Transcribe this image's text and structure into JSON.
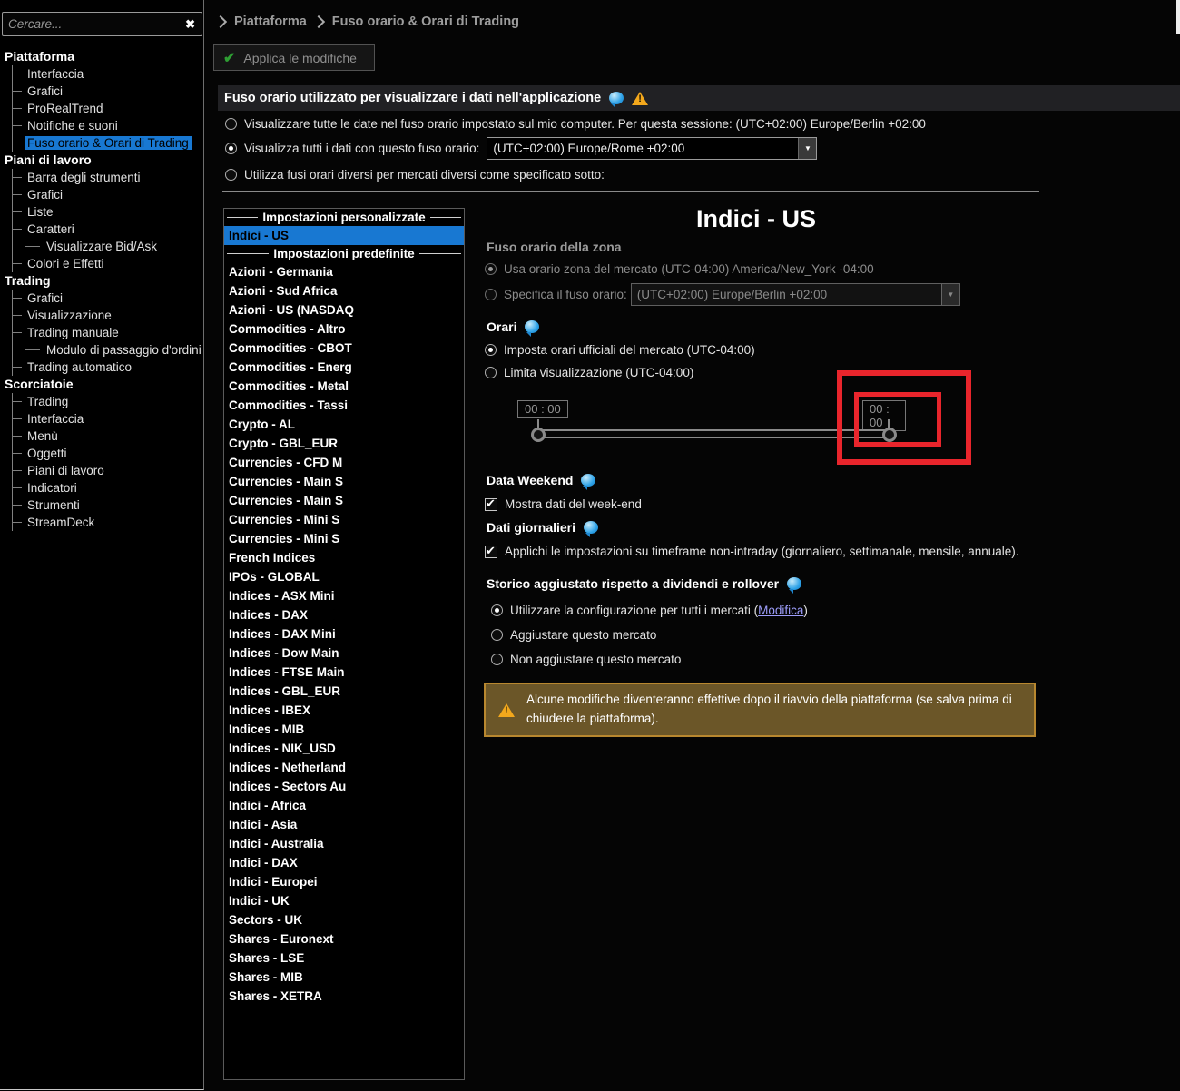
{
  "search": {
    "placeholder": "Cercare...",
    "clear_icon": "✖"
  },
  "breadcrumb": {
    "items": [
      "Piattaforma",
      "Fuso orario & Orari di Trading"
    ]
  },
  "toolbar": {
    "apply_label": "Applica le modifiche"
  },
  "timezone_header": {
    "title": "Fuso orario utilizzato per visualizzare i dati nell'applicazione"
  },
  "timezone_options": {
    "option1": "Visualizzare tutte le date nel fuso orario impostato sul mio computer. Per questa sessione: (UTC+02:00) Europe/Berlin +02:00",
    "option2": "Visualizza tutti i dati con questo fuso orario:",
    "option2_value": "(UTC+02:00) Europe/Rome +02:00",
    "option3": "Utilizza fusi orari diversi per mercati diversi come specificato sotto:"
  },
  "sidebar": {
    "tree": [
      {
        "type": "section",
        "label": "Piattaforma"
      },
      {
        "type": "item",
        "label": "Interfaccia"
      },
      {
        "type": "item",
        "label": "Grafici"
      },
      {
        "type": "item",
        "label": "ProRealTrend"
      },
      {
        "type": "item",
        "label": "Notifiche e suoni"
      },
      {
        "type": "item",
        "label": "Fuso orario & Orari di Trading",
        "selected": true
      },
      {
        "type": "section",
        "label": "Piani di lavoro"
      },
      {
        "type": "item",
        "label": "Barra degli strumenti"
      },
      {
        "type": "item",
        "label": "Grafici"
      },
      {
        "type": "item",
        "label": "Liste"
      },
      {
        "type": "item",
        "label": "Caratteri"
      },
      {
        "type": "subitem",
        "label": "Visualizzare Bid/Ask"
      },
      {
        "type": "item",
        "label": "Colori e Effetti"
      },
      {
        "type": "section",
        "label": "Trading"
      },
      {
        "type": "item",
        "label": "Grafici"
      },
      {
        "type": "item",
        "label": "Visualizzazione"
      },
      {
        "type": "item",
        "label": "Trading manuale"
      },
      {
        "type": "subitem",
        "label": "Modulo di passaggio d'ordini"
      },
      {
        "type": "item",
        "label": "Trading automatico"
      },
      {
        "type": "section",
        "label": "Scorciatoie"
      },
      {
        "type": "item",
        "label": "Trading"
      },
      {
        "type": "item",
        "label": "Interfaccia"
      },
      {
        "type": "item",
        "label": "Menù"
      },
      {
        "type": "item",
        "label": "Oggetti"
      },
      {
        "type": "item",
        "label": "Piani di lavoro"
      },
      {
        "type": "item",
        "label": "Indicatori"
      },
      {
        "type": "item",
        "label": "Strumenti"
      },
      {
        "type": "item",
        "label": "StreamDeck"
      }
    ]
  },
  "market_list": {
    "items": [
      {
        "type": "header",
        "label": "Impostazioni personalizzate"
      },
      {
        "type": "item",
        "label": "Indici - US",
        "selected": true
      },
      {
        "type": "header",
        "label": "Impostazioni predefinite"
      },
      {
        "type": "item",
        "label": "Azioni - Germania"
      },
      {
        "type": "item",
        "label": "Azioni - Sud Africa"
      },
      {
        "type": "item",
        "label": "Azioni - US (NASDAQ"
      },
      {
        "type": "item",
        "label": "Commodities - Altro"
      },
      {
        "type": "item",
        "label": "Commodities - CBOT"
      },
      {
        "type": "item",
        "label": "Commodities - Energ"
      },
      {
        "type": "item",
        "label": "Commodities - Metal"
      },
      {
        "type": "item",
        "label": "Commodities - Tassi"
      },
      {
        "type": "item",
        "label": "Crypto - AL"
      },
      {
        "type": "item",
        "label": "Crypto - GBL_EUR"
      },
      {
        "type": "item",
        "label": "Currencies - CFD M"
      },
      {
        "type": "item",
        "label": "Currencies - Main S"
      },
      {
        "type": "item",
        "label": "Currencies - Main S"
      },
      {
        "type": "item",
        "label": "Currencies - Mini S"
      },
      {
        "type": "item",
        "label": "Currencies - Mini S"
      },
      {
        "type": "item",
        "label": "French Indices"
      },
      {
        "type": "item",
        "label": "IPOs - GLOBAL"
      },
      {
        "type": "item",
        "label": "Indices - ASX Mini"
      },
      {
        "type": "item",
        "label": "Indices - DAX"
      },
      {
        "type": "item",
        "label": "Indices - DAX Mini"
      },
      {
        "type": "item",
        "label": "Indices - Dow Main"
      },
      {
        "type": "item",
        "label": "Indices - FTSE Main"
      },
      {
        "type": "item",
        "label": "Indices - GBL_EUR"
      },
      {
        "type": "item",
        "label": "Indices - IBEX"
      },
      {
        "type": "item",
        "label": "Indices - MIB"
      },
      {
        "type": "item",
        "label": "Indices - NIK_USD"
      },
      {
        "type": "item",
        "label": "Indices - Netherland"
      },
      {
        "type": "item",
        "label": "Indices - Sectors Au"
      },
      {
        "type": "item",
        "label": "Indici - Africa"
      },
      {
        "type": "item",
        "label": "Indici - Asia"
      },
      {
        "type": "item",
        "label": "Indici - Australia"
      },
      {
        "type": "item",
        "label": "Indici - DAX"
      },
      {
        "type": "item",
        "label": "Indici - Europei"
      },
      {
        "type": "item",
        "label": "Indici - UK"
      },
      {
        "type": "item",
        "label": "Sectors - UK"
      },
      {
        "type": "item",
        "label": "Shares - Euronext"
      },
      {
        "type": "item",
        "label": "Shares - LSE"
      },
      {
        "type": "item",
        "label": "Shares - MIB"
      },
      {
        "type": "item",
        "label": "Shares - XETRA"
      }
    ]
  },
  "detail": {
    "title": "Indici - US",
    "zone_section": {
      "label": "Fuso orario della zona",
      "option1": "Usa orario zona del mercato (UTC-04:00) America/New_York -04:00",
      "option2": "Specifica il fuso orario:",
      "option2_value": "(UTC+02:00) Europe/Berlin +02:00"
    },
    "hours_section": {
      "label": "Orari",
      "option1": "Imposta orari ufficiali del mercato (UTC-04:00)",
      "option2": "Limita visualizzazione (UTC-04:00)",
      "slider_start": "00 : 00",
      "slider_end": "00 : 00"
    },
    "weekend_section": {
      "label": "Data Weekend",
      "checkbox": "Mostra dati del week-end"
    },
    "daily_section": {
      "label": "Dati giornalieri",
      "checkbox": "Applichi le impostazioni su timeframe non-intraday (giornaliero, settimanale, mensile, annuale)."
    },
    "history_section": {
      "label": "Storico aggiustato rispetto a dividendi e rollover",
      "option1_prefix": "Utilizzare la configurazione per tutti i mercati (",
      "option1_link": "Modifica",
      "option1_suffix": ")",
      "option2": "Aggiustare questo mercato",
      "option3": "Non aggiustare questo mercato"
    },
    "warning": "Alcune modifiche diventeranno effettive dopo il riavvio della piattaforma (se salva prima di chiudere la piattaforma)."
  },
  "colors": {
    "selection_blue": "#1878d2",
    "link": "#9d9dfa",
    "warning_bg": "#6b5628",
    "warning_border": "#b8872f",
    "red_annotation": "#e9252c",
    "help_bubble": "#2fa3e8",
    "warn_yellow": "#f3a81c",
    "check_green": "#2e9e33"
  }
}
